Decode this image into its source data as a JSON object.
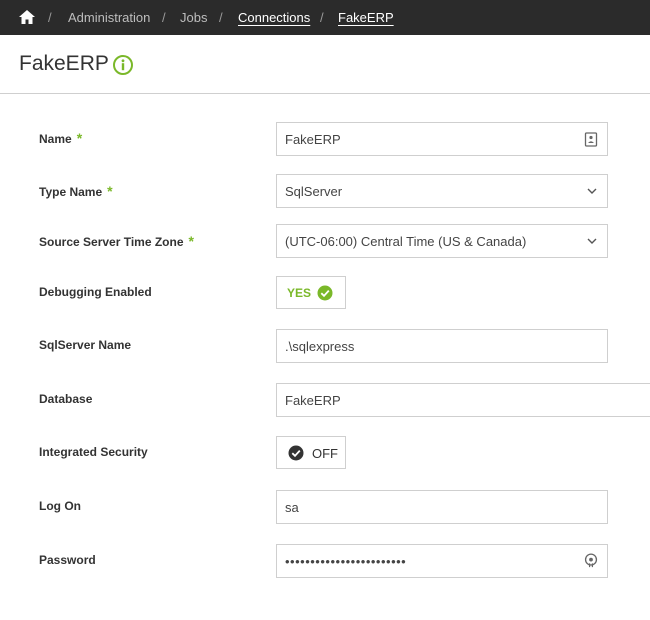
{
  "breadcrumb": {
    "items": [
      {
        "label": "Administration"
      },
      {
        "label": "Jobs"
      },
      {
        "label": "Connections"
      },
      {
        "label": "FakeERP"
      }
    ],
    "separator": "/"
  },
  "page": {
    "title": "FakeERP"
  },
  "form": {
    "required_marker": "*",
    "name": {
      "label": "Name",
      "value": "FakeERP"
    },
    "type_name": {
      "label": "Type Name",
      "value": "SqlServer"
    },
    "time_zone": {
      "label": "Source Server Time Zone",
      "value": "(UTC-06:00) Central Time (US & Canada)"
    },
    "debugging": {
      "label": "Debugging Enabled",
      "value": "YES"
    },
    "sqlserver_name": {
      "label": "SqlServer Name",
      "value": ".\\sqlexpress"
    },
    "database": {
      "label": "Database",
      "value": "FakeERP"
    },
    "integrated_security": {
      "label": "Integrated Security",
      "value": "OFF"
    },
    "log_on": {
      "label": "Log On",
      "value": "sa"
    },
    "password": {
      "label": "Password",
      "value": "••••••••••••••••••••••••"
    }
  },
  "colors": {
    "topbar": "#2b2b2b",
    "accent": "#7ab829",
    "border": "#cfcfcf"
  }
}
